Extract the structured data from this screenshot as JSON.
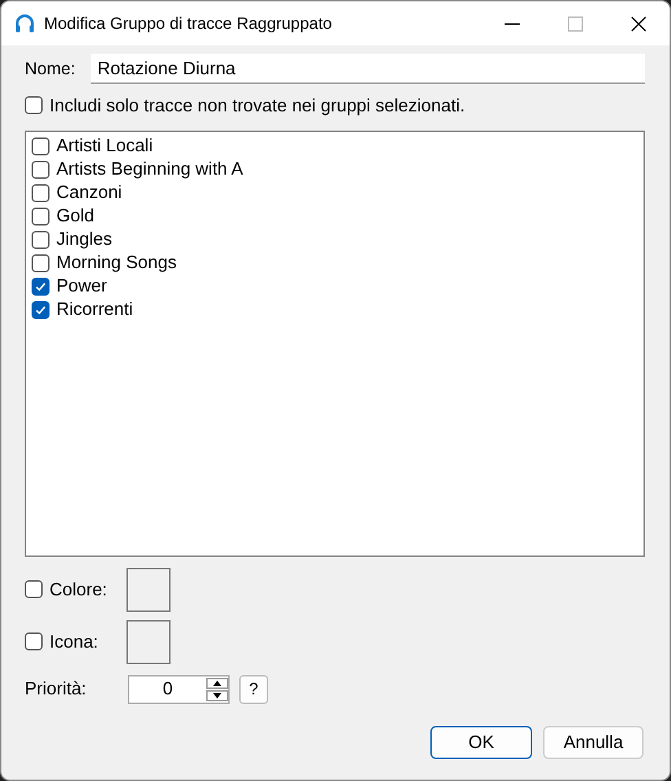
{
  "window": {
    "title": "Modifica Gruppo di tracce Raggruppato"
  },
  "name_field": {
    "label": "Nome:",
    "value": "Rotazione Diurna"
  },
  "exclude_option": {
    "label": "Includi solo tracce non trovate nei gruppi selezionati.",
    "checked": false
  },
  "groups": [
    {
      "label": "Artisti Locali",
      "checked": false
    },
    {
      "label": "Artists Beginning with A",
      "checked": false
    },
    {
      "label": "Canzoni",
      "checked": false
    },
    {
      "label": "Gold",
      "checked": false
    },
    {
      "label": "Jingles",
      "checked": false
    },
    {
      "label": "Morning Songs",
      "checked": false
    },
    {
      "label": "Power",
      "checked": true
    },
    {
      "label": "Ricorrenti",
      "checked": true
    }
  ],
  "color_option": {
    "label": "Colore:",
    "checked": false
  },
  "icon_option": {
    "label": "Icona:",
    "checked": false
  },
  "priority": {
    "label": "Priorità:",
    "value": "0",
    "help": "?"
  },
  "buttons": [
    {
      "label": "OK",
      "default": true
    },
    {
      "label": "Annulla",
      "default": false
    }
  ]
}
